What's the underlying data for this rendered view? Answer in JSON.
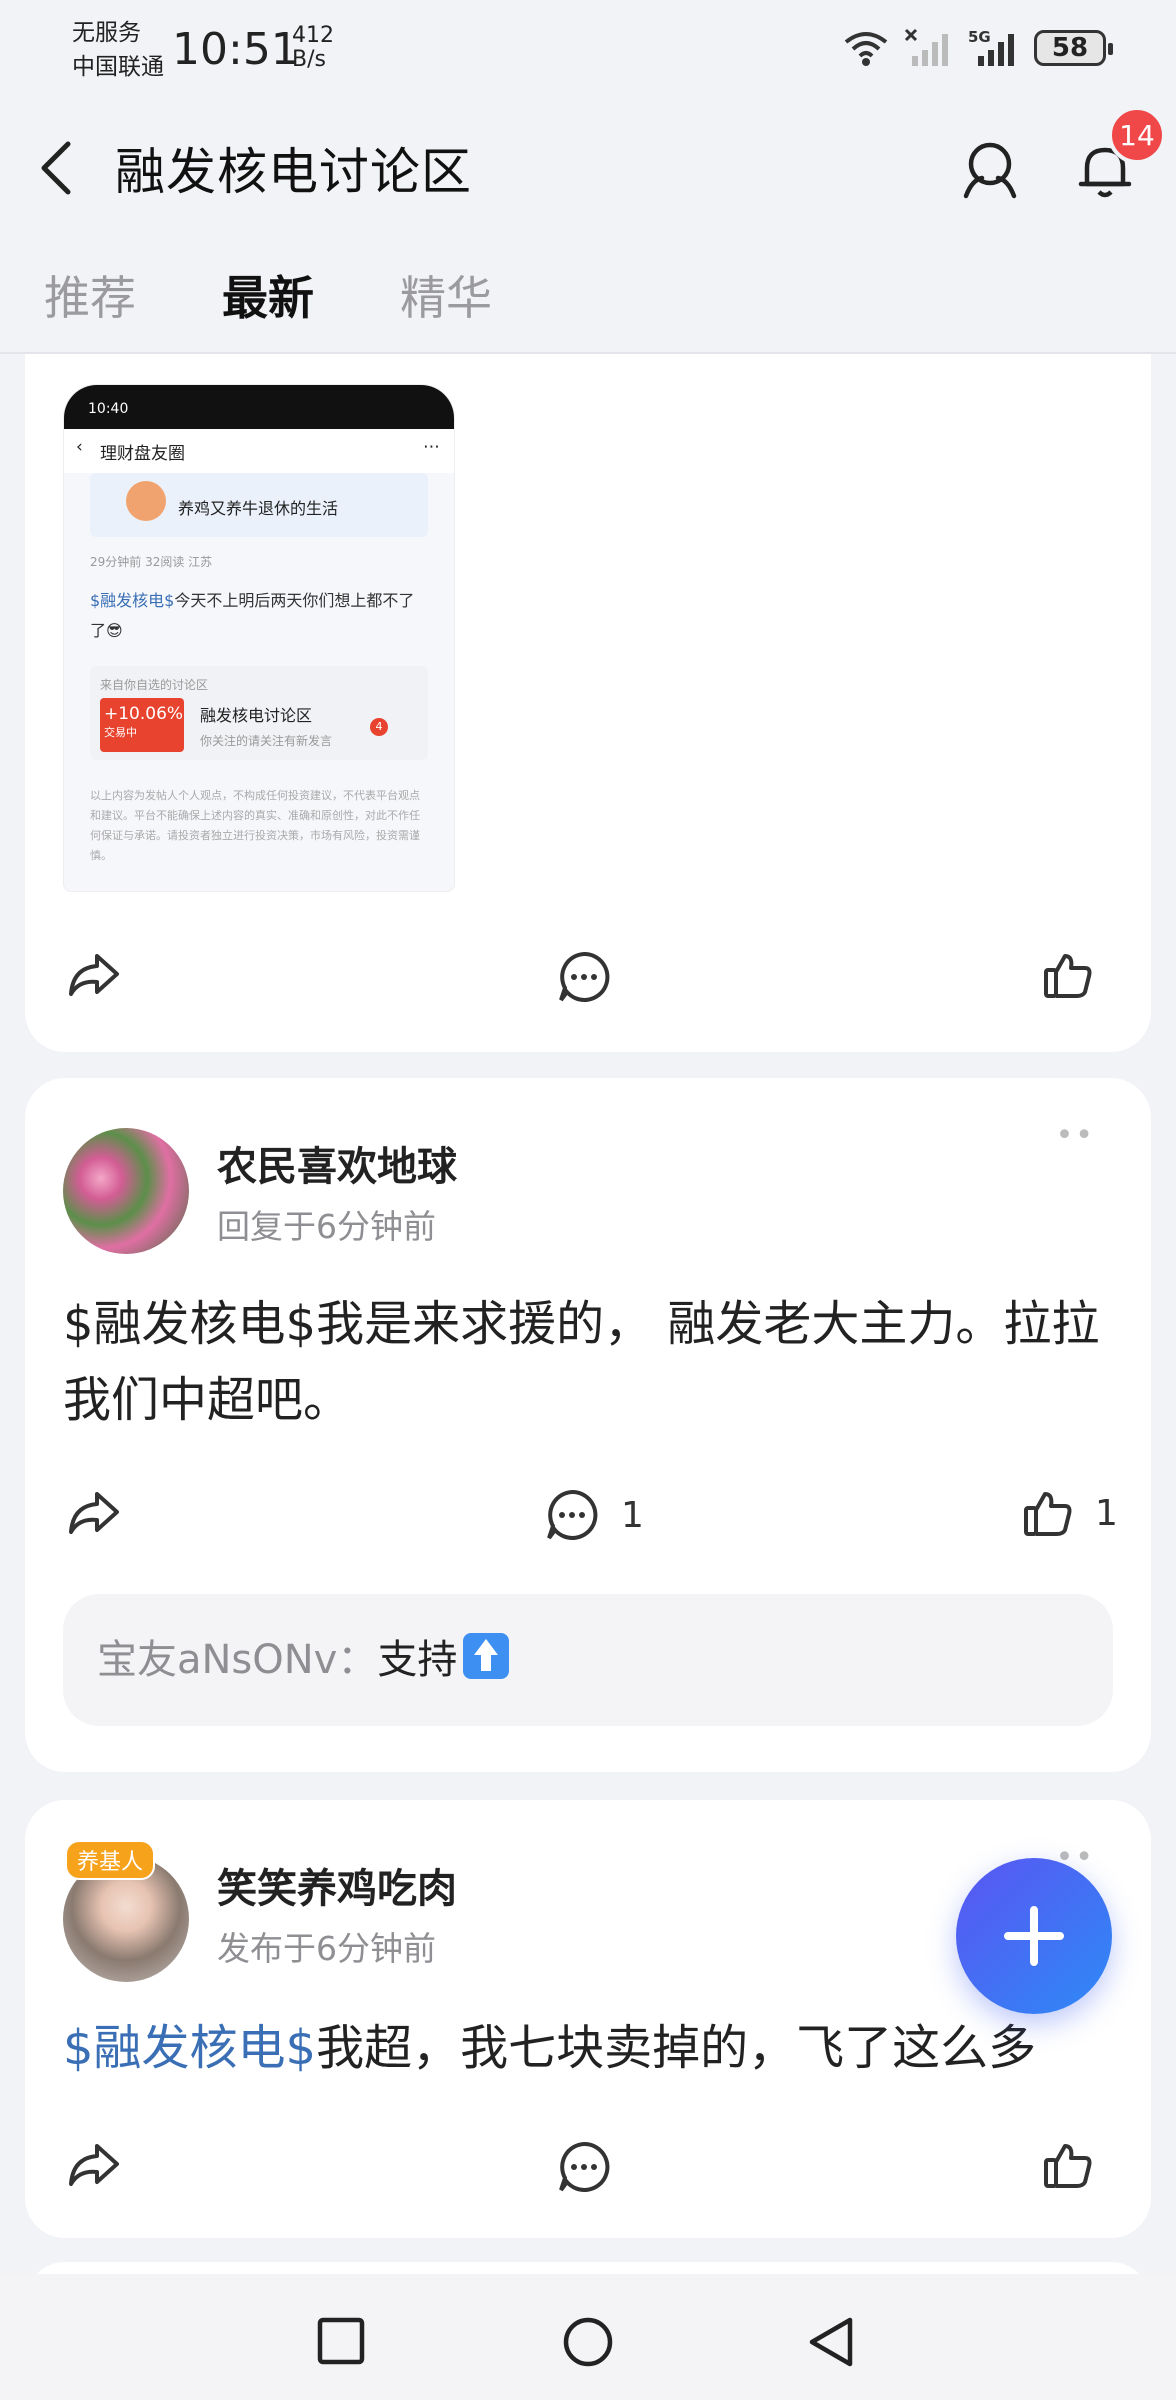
{
  "status_bar": {
    "carrier_line1": "无服务",
    "carrier_line2": "中国联通",
    "time": "10:51",
    "speed_value": "412",
    "speed_unit": "B/s",
    "network": "5G",
    "battery": "58"
  },
  "header": {
    "title": "融发核电讨论区",
    "notification_count": "14"
  },
  "tabs": [
    "推荐",
    "最新",
    "精华"
  ],
  "active_tab": "最新",
  "posts": [
    {
      "embedded_screenshot": {
        "status_time": "10:40",
        "nav_title": "理财盘友圈",
        "user": "养鸡又养牛退休的生活",
        "meta": "29分钟前   32阅读   江苏",
        "text_tag": "$融发核电$",
        "text": "今天不上明后两天你们想上都不了了😎",
        "forum_from": "来自你自选的讨论区",
        "forum_pct": "+10.06%",
        "forum_state": "交易中",
        "forum_name": "融发核电讨论区",
        "forum_sub": "你关注的请关注有新发言",
        "forum_count": "4",
        "disclaimer": "以上内容为发帖人个人观点，不构成任何投资建议，不代表平台观点和建议。平台不能确保上述内容的真实、准确和原创性，对此不作任何保证与承诺。请投资者独立进行投资决策，市场有风险，投资需谨慎。"
      }
    },
    {
      "username": "农民喜欢地球",
      "time": "回复于6分钟前",
      "content": "$融发核电$我是来求援的， 融发老大主力。拉拉我们中超吧。",
      "comment_count": "1",
      "like_count": "1",
      "comment": {
        "user": "宝友aNsONv：",
        "text": "支持"
      }
    },
    {
      "username": "笑笑养鸡吃肉",
      "avatar_badge": "养基人",
      "time": "发布于6分钟前",
      "content_tag": "$融发核电$",
      "content": "我超，我七块卖掉的，飞了这么多"
    }
  ],
  "colors": {
    "accent": "#3a6fb5",
    "badge": "#f04848",
    "fab": "#3d7ef4"
  }
}
